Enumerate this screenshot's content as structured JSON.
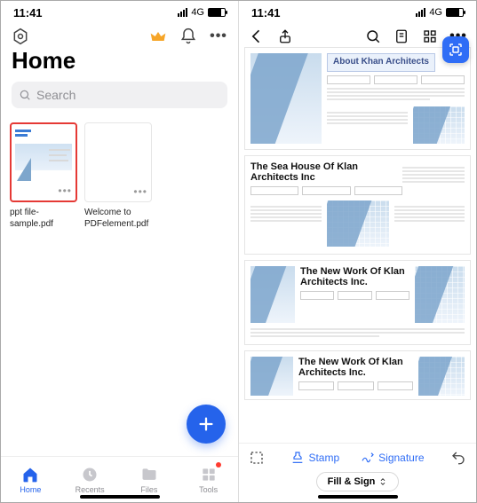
{
  "left": {
    "status": {
      "time": "11:41",
      "network": "4G"
    },
    "title": "Home",
    "search": {
      "placeholder": "Search"
    },
    "files": [
      {
        "name": "ppt file-sample.pdf",
        "selected": true
      },
      {
        "name": "Welcome to PDFelement.pdf",
        "selected": false
      }
    ],
    "tabs": [
      {
        "label": "Home",
        "icon": "home",
        "active": true
      },
      {
        "label": "Recents",
        "icon": "clock",
        "active": false
      },
      {
        "label": "Files",
        "icon": "folder",
        "active": false
      },
      {
        "label": "Tools",
        "icon": "tools",
        "active": false,
        "badge": true
      }
    ]
  },
  "right": {
    "status": {
      "time": "11:41",
      "network": "4G"
    },
    "document": {
      "cover_title": "About Khan Architects",
      "sections": [
        {
          "title": "The Sea House Of Klan Architects Inc"
        },
        {
          "title": "The New Work Of Klan Architects Inc."
        },
        {
          "title": "The New Work Of Klan Architects Inc."
        }
      ]
    },
    "tools": {
      "stamp": "Stamp",
      "signature": "Signature"
    },
    "mode_pill": "Fill & Sign"
  }
}
